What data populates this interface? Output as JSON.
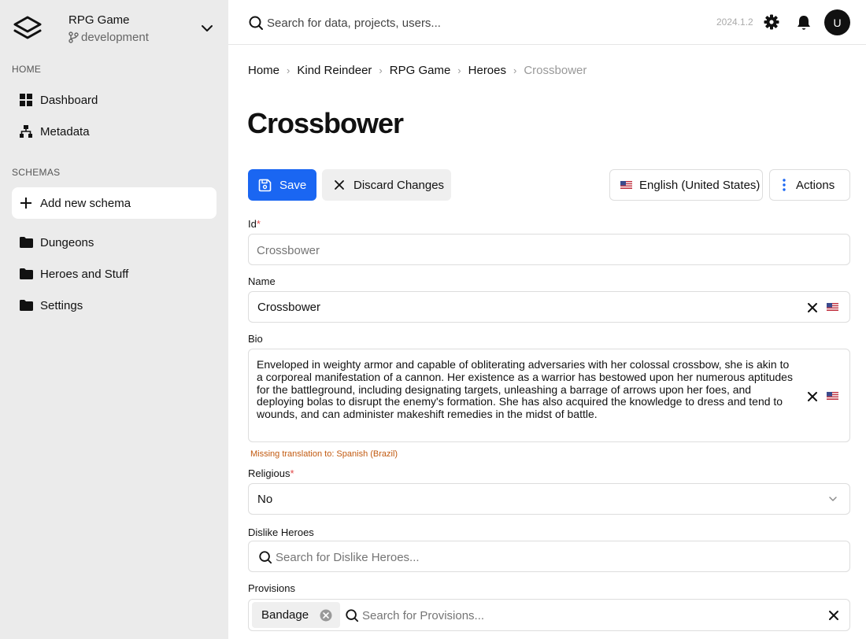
{
  "project": {
    "name": "RPG Game",
    "branch": "development"
  },
  "sidebar": {
    "home_label": "HOME",
    "home_items": [
      {
        "label": "Dashboard",
        "icon": "grid-icon"
      },
      {
        "label": "Metadata",
        "icon": "hierarchy-icon"
      }
    ],
    "schemas_label": "SCHEMAS",
    "add_schema": "Add new schema",
    "schema_items": [
      {
        "label": "Dungeons",
        "icon": "folder-icon"
      },
      {
        "label": "Heroes and Stuff",
        "icon": "folder-icon"
      },
      {
        "label": "Settings",
        "icon": "folder-icon"
      }
    ]
  },
  "header": {
    "search_placeholder": "Search for data, projects, users...",
    "version": "2024.1.2",
    "avatar_initial": "U"
  },
  "breadcrumbs": [
    "Home",
    "Kind Reindeer",
    "RPG Game",
    "Heroes",
    "Crossbower"
  ],
  "page": {
    "title": "Crossbower"
  },
  "toolbar": {
    "save": "Save",
    "discard": "Discard Changes",
    "language": "English (United States)",
    "actions": "Actions"
  },
  "fields": {
    "id": {
      "label": "Id",
      "required_mark": "*",
      "placeholder": "Crossbower"
    },
    "name": {
      "label": "Name",
      "value": "Crossbower"
    },
    "bio": {
      "label": "Bio",
      "value": "Enveloped in weighty armor and capable of obliterating adversaries with her colossal crossbow, she is akin to a corporeal manifestation of a cannon. Her existence as a warrior has bestowed upon her numerous aptitudes for the battleground, including designating targets, unleashing a barrage of arrows upon her foes, and deploying bolas to disrupt the enemy's formation. She has also acquired the knowledge to dress and tend to wounds, and can administer makeshift remedies in the midst of battle.",
      "warning": "Missing translation to: Spanish (Brazil)"
    },
    "religious": {
      "label": "Religious",
      "required_mark": "*",
      "value": "No"
    },
    "dislike_heroes": {
      "label": "Dislike Heroes",
      "placeholder": "Search for Dislike Heroes..."
    },
    "provisions": {
      "label": "Provisions",
      "tags": [
        "Bandage"
      ],
      "placeholder": "Search for Provisions..."
    }
  },
  "colors": {
    "accent": "#1a66f2",
    "sidebar_bg": "#ebebeb",
    "warning": "#c25a10",
    "required": "#e14a4a"
  }
}
